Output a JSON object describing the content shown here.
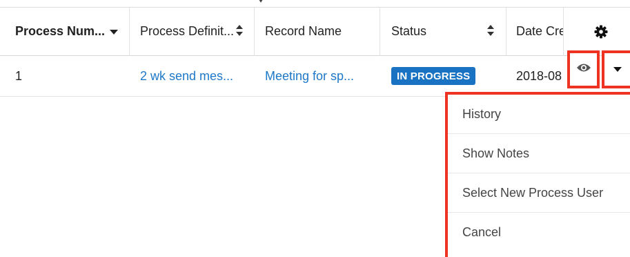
{
  "table": {
    "columns": [
      {
        "label": "Process Num...",
        "sort": "down"
      },
      {
        "label": "Process Definit...",
        "sort": "both"
      },
      {
        "label": "Record Name",
        "sort": "none"
      },
      {
        "label": "Status",
        "sort": "both"
      },
      {
        "label": "Date Cre",
        "sort": "none"
      }
    ],
    "settings_icon": "gear-icon",
    "rows": [
      {
        "process_number": "1",
        "process_definition": "2 wk send mes...",
        "record_name": "Meeting for sp...",
        "status": "IN PROGRESS",
        "date_created": "2018-08"
      }
    ],
    "row_actions": {
      "preview_icon": "eye-icon",
      "more_icon": "caret-down-icon"
    }
  },
  "menu": {
    "items": [
      {
        "label": "History"
      },
      {
        "label": "Show Notes"
      },
      {
        "label": "Select New Process User"
      },
      {
        "label": "Cancel"
      }
    ]
  },
  "colors": {
    "link": "#1e78c8",
    "badge": "#1a73c2",
    "highlight": "#ee3322"
  }
}
